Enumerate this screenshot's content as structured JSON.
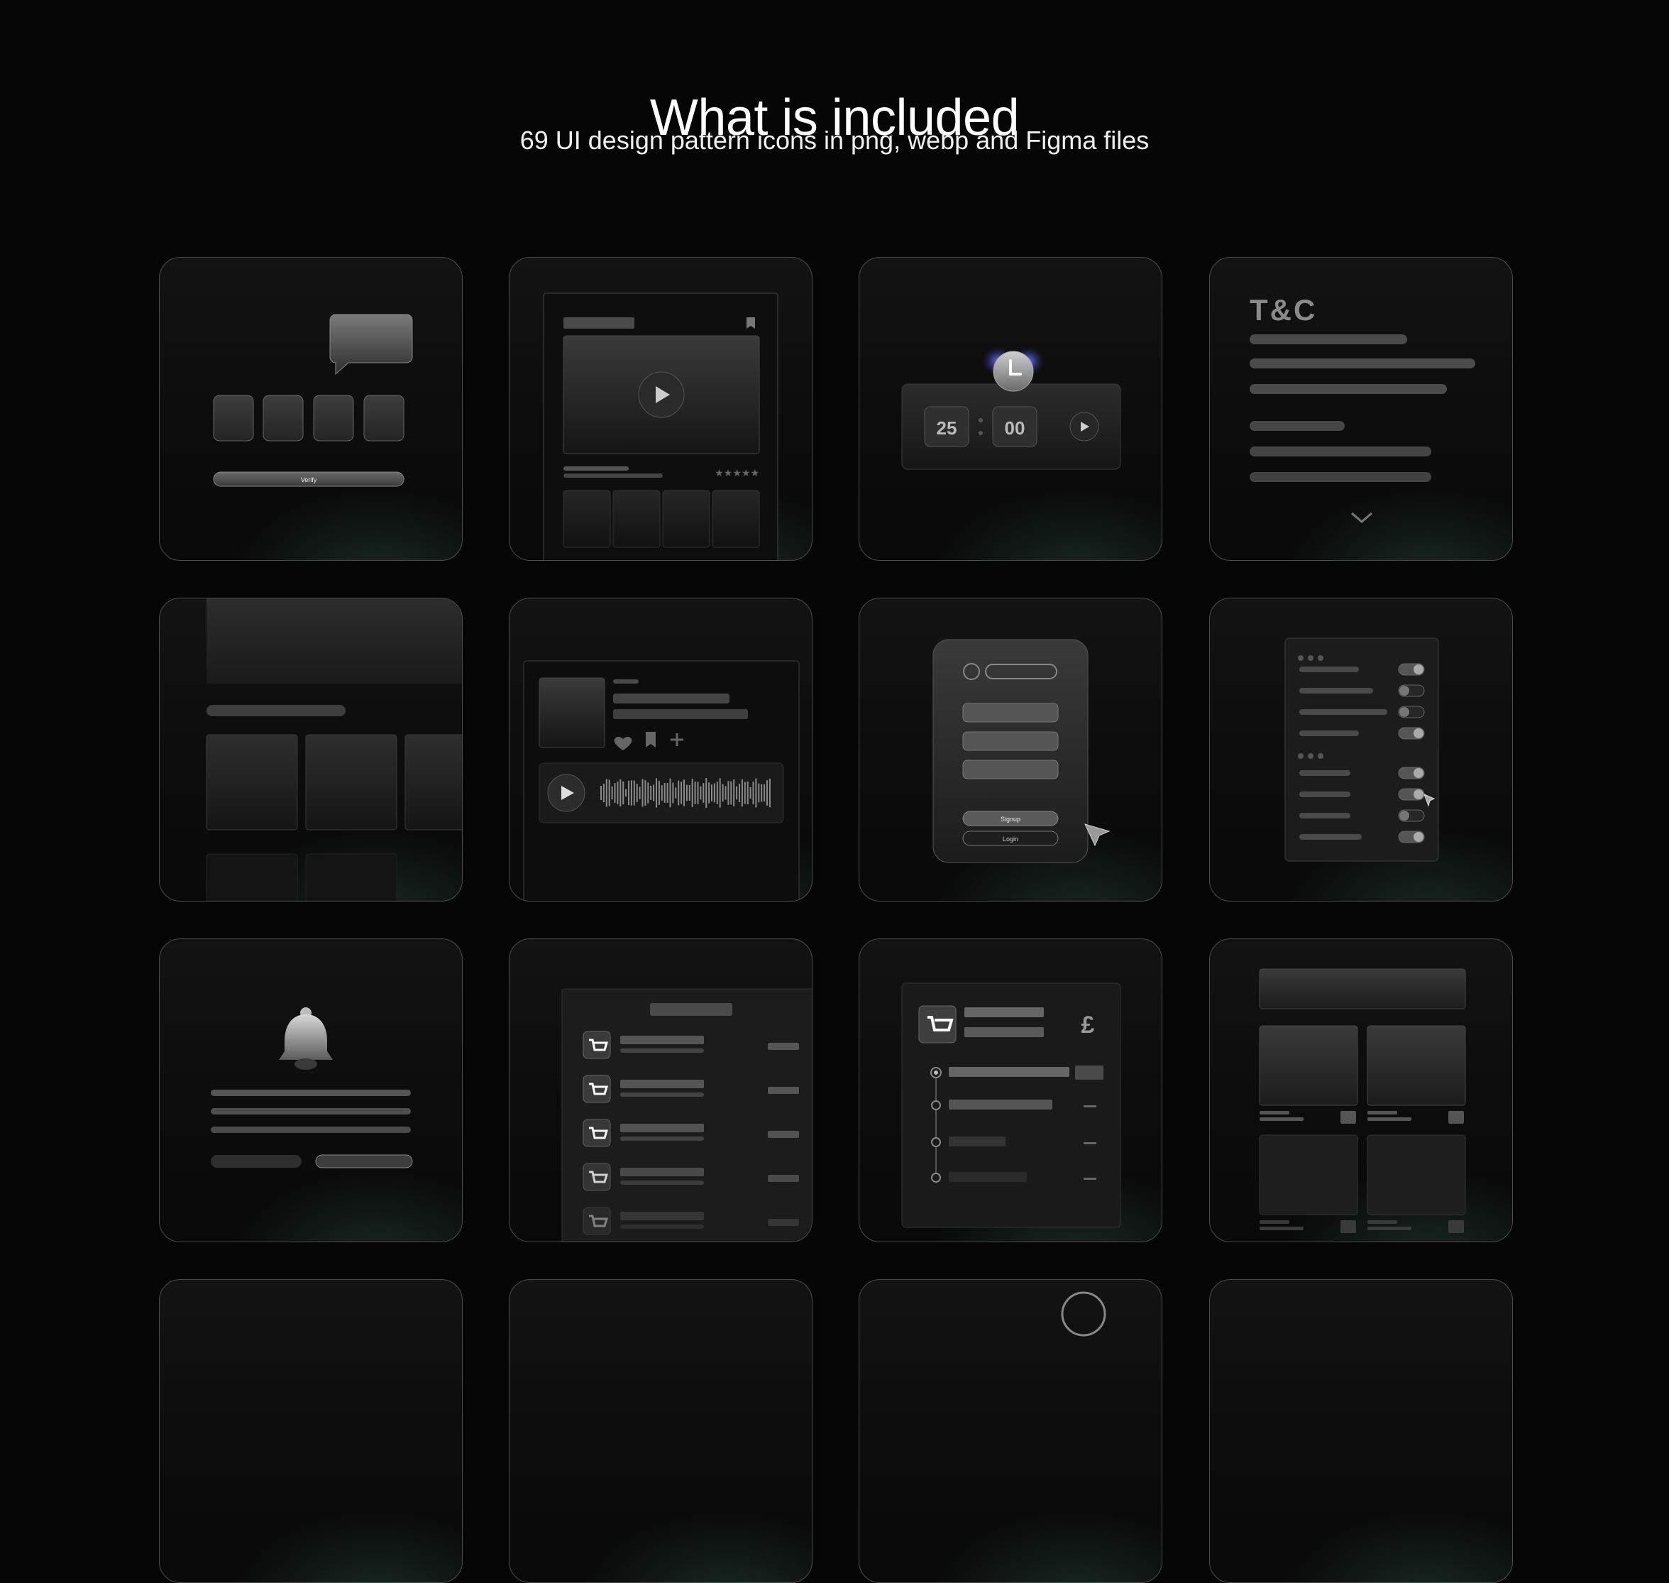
{
  "header": {
    "title": "What is included",
    "subtitle": "69 UI design pattern icons in png, webp and Figma files"
  },
  "cards": {
    "otp": {
      "name": "otp-verification",
      "button_label": "Verify"
    },
    "video": {
      "name": "video-player",
      "rating": "★★★★★"
    },
    "timer": {
      "name": "pomodoro-timer",
      "minutes": "25",
      "seconds": "00"
    },
    "terms": {
      "name": "terms-and-conditions",
      "heading": "T&C"
    },
    "carousel": {
      "name": "carousel"
    },
    "audio": {
      "name": "audio-player"
    },
    "signup": {
      "name": "signup-form",
      "primary_label": "Signup",
      "secondary_label": "Login"
    },
    "settings": {
      "name": "settings-toggles"
    },
    "notification": {
      "name": "notification-prompt"
    },
    "cart_list": {
      "name": "cart-list"
    },
    "order_tracking": {
      "name": "order-tracking",
      "currency_symbol": "£"
    },
    "grid": {
      "name": "product-grid"
    }
  },
  "colors": {
    "background": "#050505",
    "card_border": "#4c4c4c",
    "glow": "#488c76",
    "accent_blue": "#3a4fd8"
  }
}
